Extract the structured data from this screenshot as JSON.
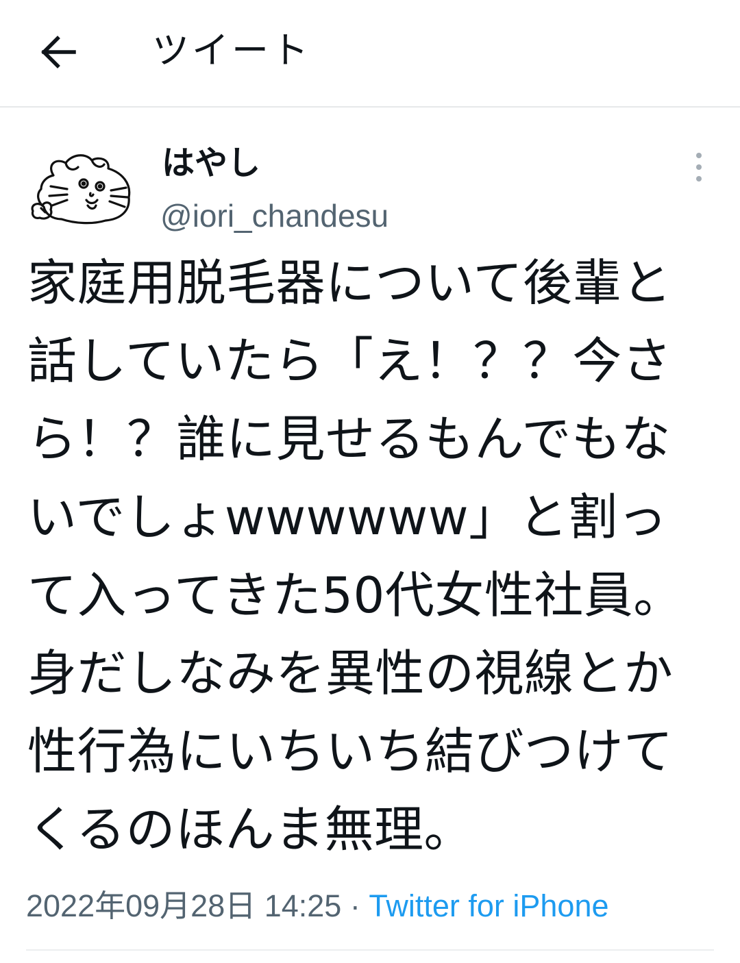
{
  "header": {
    "back_icon": "arrow-left-icon",
    "title": "ツイート"
  },
  "tweet": {
    "avatar_icon": "hamster-drawing-avatar",
    "display_name": "はやし",
    "handle": "@iori_chandesu",
    "more_icon": "more-vertical-icon",
    "text": "家庭用脱毛器について後輩と\n話していたら「え！？？今さ\nら！？誰に見せるもんでもな\nいでしょwwwwww」と割っ\nて入ってきた50代女性社員。\n身だしなみを異性の視線とか\n性行為にいちいち結びつけて\nくるのほんま無理。",
    "timestamp": "2022年09月28日 14:25",
    "separator": "·",
    "source": "Twitter for iPhone"
  },
  "colors": {
    "text": "#0f1419",
    "secondary_text": "#536471",
    "link": "#1d9bf0",
    "divider": "#e6e8ea"
  }
}
